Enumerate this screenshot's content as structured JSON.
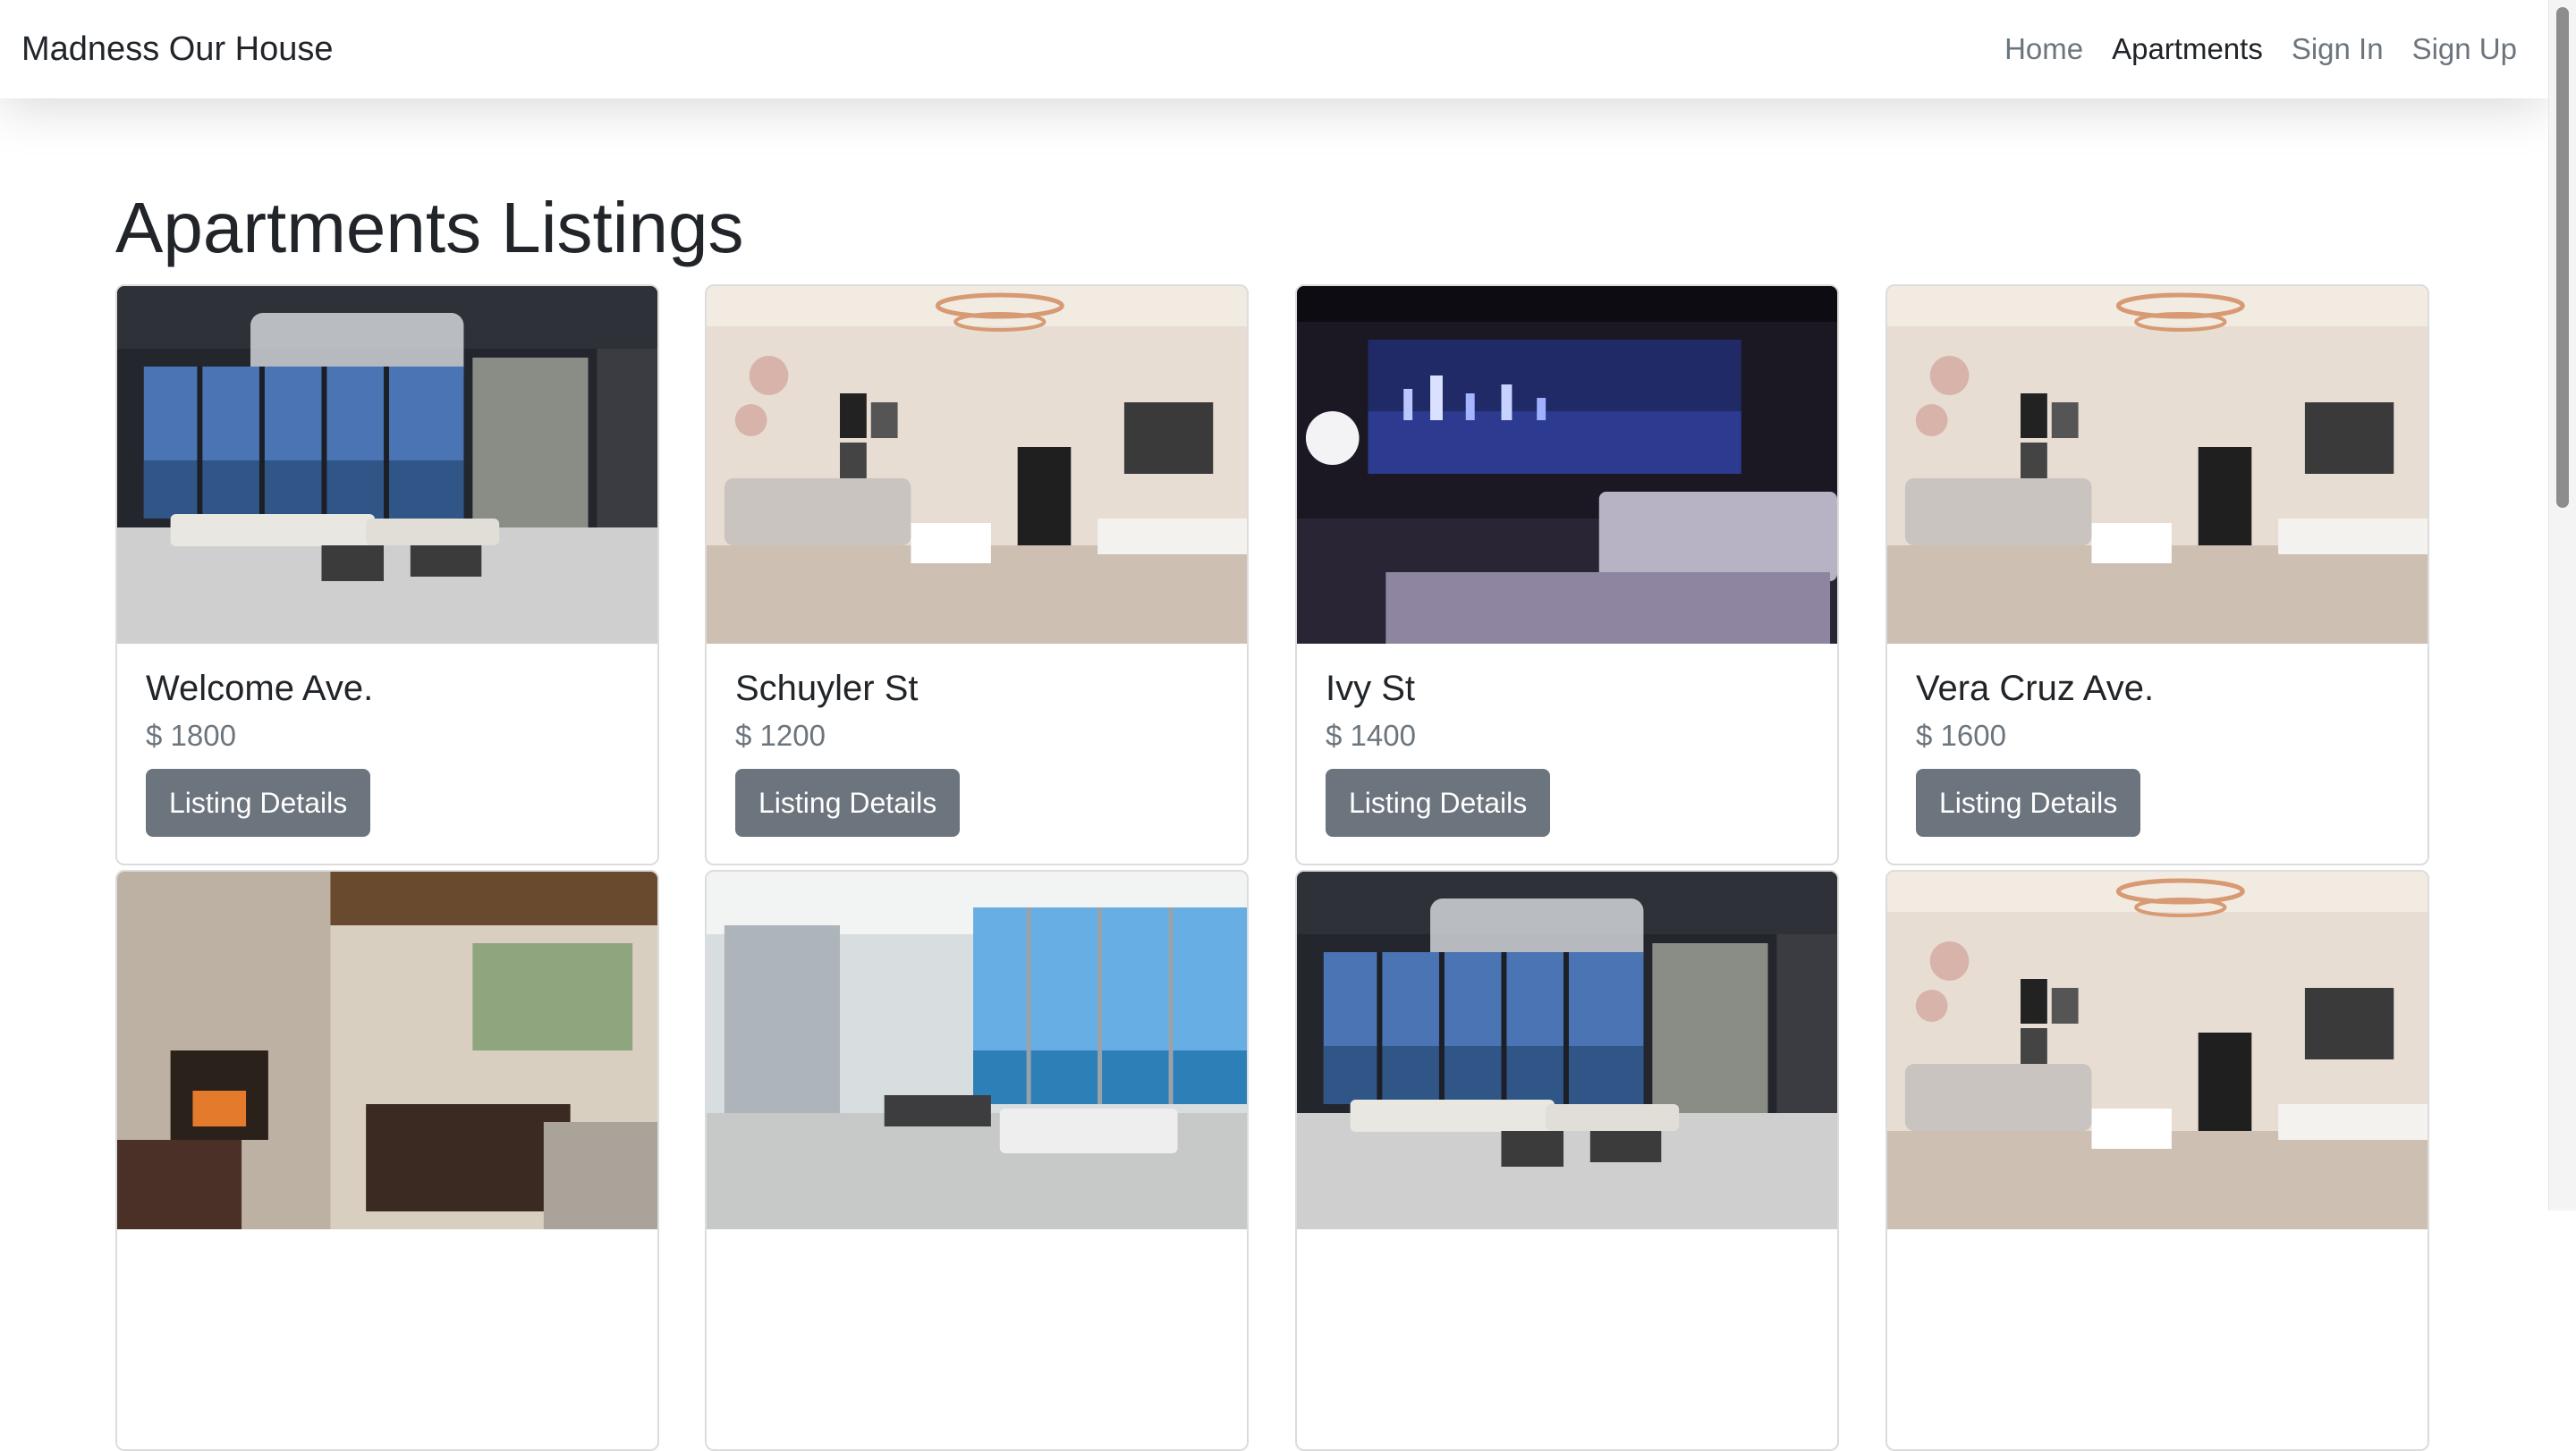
{
  "navbar": {
    "brand": "Madness Our House",
    "links": [
      {
        "label": "Home",
        "active": false
      },
      {
        "label": "Apartments",
        "active": true
      },
      {
        "label": "Sign In",
        "active": false
      },
      {
        "label": "Sign Up",
        "active": false
      }
    ]
  },
  "page": {
    "title": "Apartments Listings"
  },
  "listings": [
    {
      "title": "Welcome Ave.",
      "price": "$ 1800",
      "button": "Listing Details",
      "image": "blue-ocean-view-living-room"
    },
    {
      "title": "Schuyler St",
      "price": "$ 1200",
      "button": "Listing Details",
      "image": "beige-living-room-with-chandelier"
    },
    {
      "title": "Ivy St",
      "price": "$ 1400",
      "button": "Listing Details",
      "image": "night-city-view-bedroom"
    },
    {
      "title": "Vera Cruz Ave.",
      "price": "$ 1600",
      "button": "Listing Details",
      "image": "beige-living-room-with-chandelier"
    },
    {
      "image": "stone-fireplace-living-room"
    },
    {
      "image": "seaside-glass-loft"
    },
    {
      "image": "blue-ocean-view-living-room"
    },
    {
      "image": "beige-living-room-with-chandelier"
    }
  ]
}
